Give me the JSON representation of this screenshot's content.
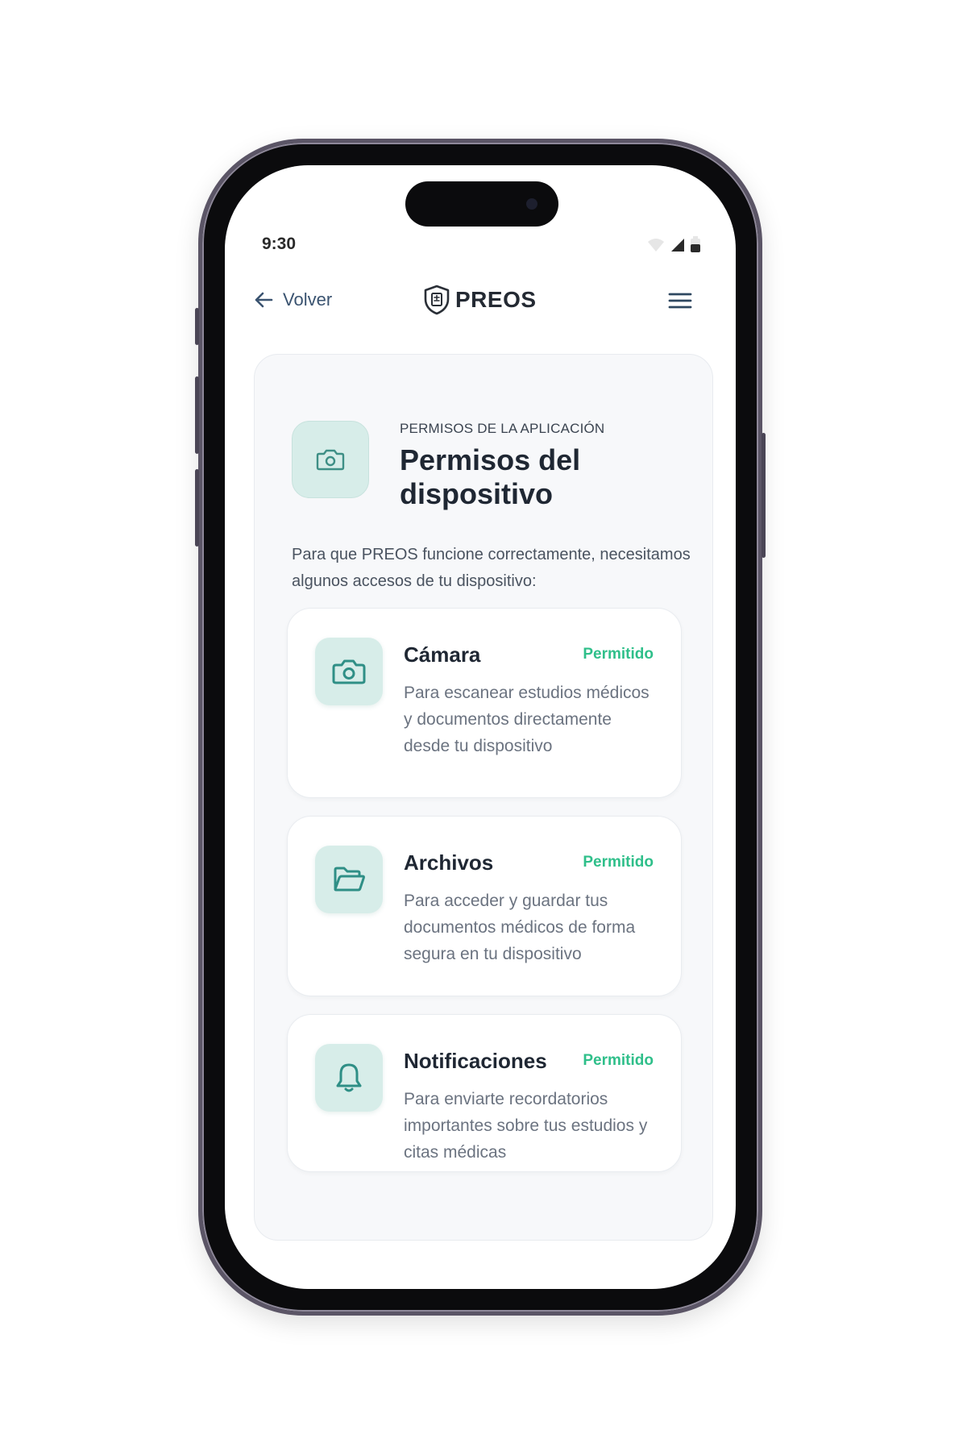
{
  "status_bar": {
    "time": "9:30"
  },
  "header": {
    "back_label": "Volver",
    "brand": "PREOS"
  },
  "intro_section": {
    "eyebrow": "PERMISOS DE LA APLICACIÓN",
    "title": "Permisos del dispositivo",
    "description": "Para que PREOS funcione correctamente, necesitamos algunos accesos de tu dispositivo:"
  },
  "permissions": [
    {
      "icon": "camera-icon",
      "name": "Cámara",
      "status": "Permitido",
      "description": "Para escanear estudios médicos y documentos directamente desde tu dispositivo"
    },
    {
      "icon": "folder-open-icon",
      "name": "Archivos",
      "status": "Permitido",
      "description": "Para acceder y guardar tus documentos médicos de forma segura en tu dispositivo"
    },
    {
      "icon": "bell-icon",
      "name": "Notificaciones",
      "status": "Permitido",
      "description": "Para enviarte recordatorios importantes sobre tus estudios y citas médicas"
    }
  ],
  "colors": {
    "accent": "#2f8f86",
    "icon_bg": "#d7ede9",
    "status_allowed": "#2fbf8a",
    "text_primary": "#1f2733",
    "link": "#3a5370"
  }
}
